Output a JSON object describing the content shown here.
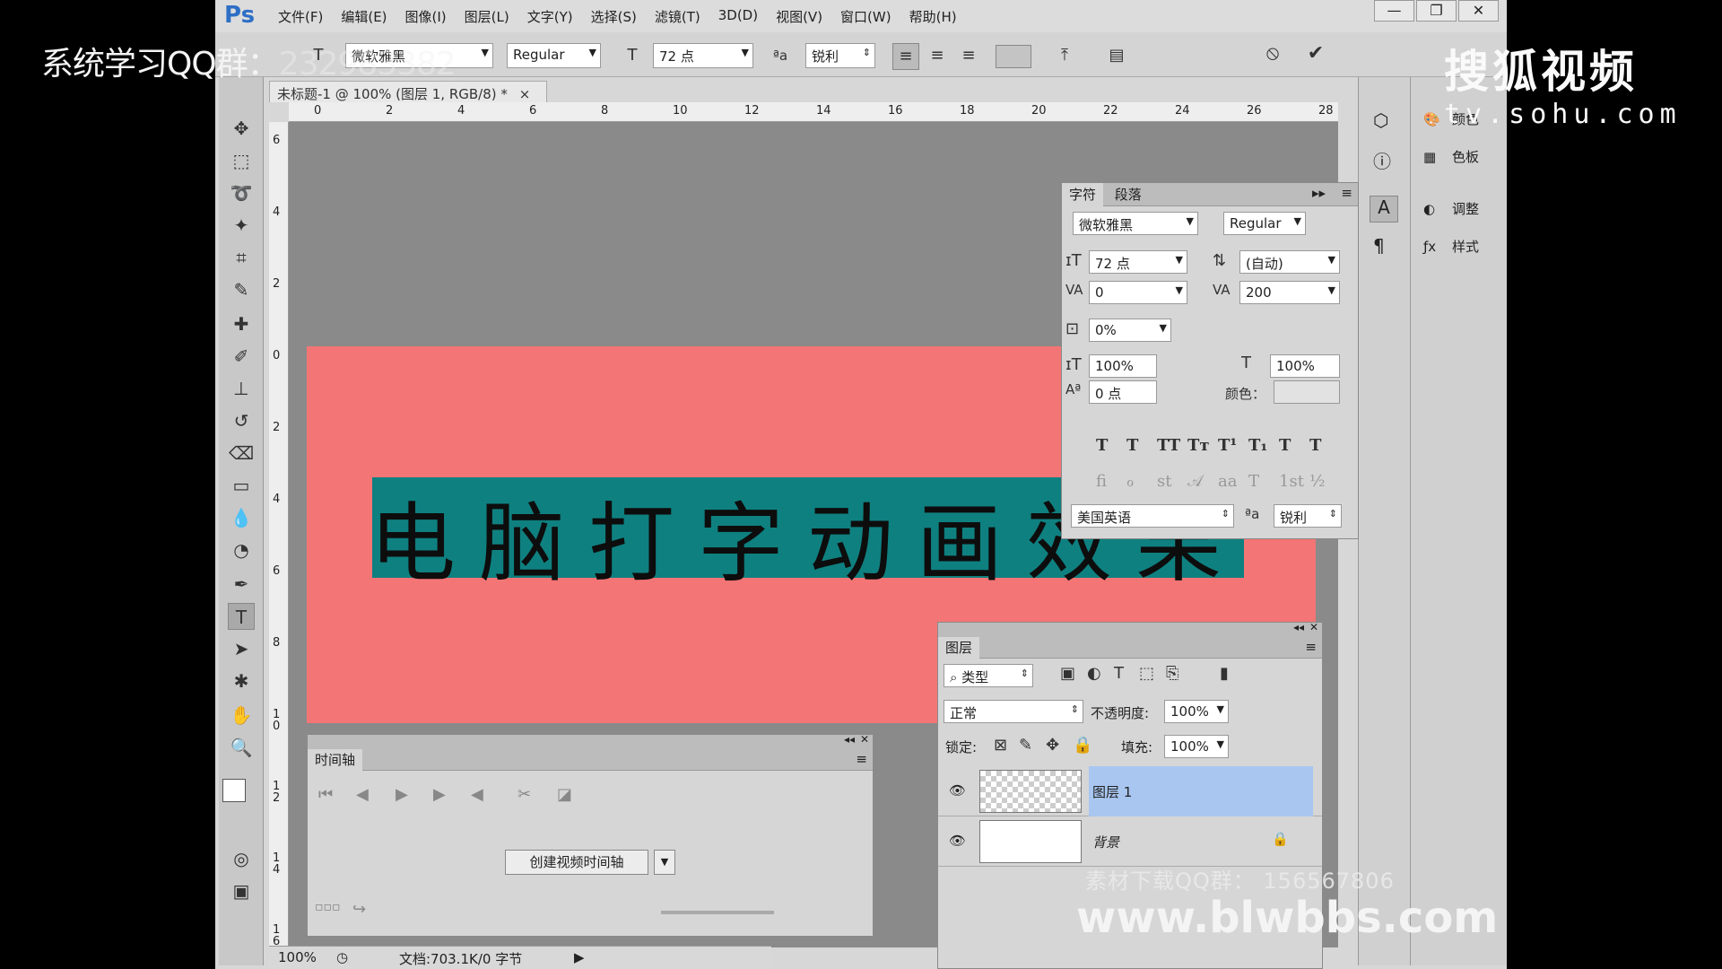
{
  "app": {
    "logo": "Ps",
    "menu": [
      "文件(F)",
      "编辑(E)",
      "图像(I)",
      "图层(L)",
      "文字(Y)",
      "选择(S)",
      "滤镜(T)",
      "3D(D)",
      "视图(V)",
      "窗口(W)",
      "帮助(H)"
    ],
    "window_buttons": [
      "—",
      "❐",
      "✕"
    ]
  },
  "options": {
    "font": "微软雅黑",
    "style": "Regular",
    "size": "72 点",
    "aa": "锐利",
    "cancel_icon": "⦸",
    "commit_icon": "✔"
  },
  "document": {
    "tab": "未标题-1 @ 100% (图层 1, RGB/8) *",
    "tab_close": "×",
    "ruler_h": [
      "0",
      "2",
      "4",
      "6",
      "8",
      "10",
      "12",
      "14",
      "16",
      "18",
      "20",
      "22",
      "24",
      "26",
      "28"
    ],
    "ruler_v": [
      "6",
      "4",
      "2",
      "0",
      "2",
      "4",
      "6",
      "8",
      "1\n0",
      "1\n2",
      "1\n4",
      "1\n6"
    ],
    "text": "电脑打字动画效果",
    "canvas_color": "#f47575",
    "selection_color": "#0f8080"
  },
  "status": {
    "zoom": "100%",
    "doc_info": "文档:703.1K/0 字节"
  },
  "character_panel": {
    "tabs": [
      "字符",
      "段落"
    ],
    "font": "微软雅黑",
    "style": "Regular",
    "size": "72 点",
    "leading": "(自动)",
    "kerning": "0",
    "tracking": "200",
    "scale_percent": "0%",
    "vscale": "100%",
    "hscale": "100%",
    "baseline": "0 点",
    "color_label": "颜色：",
    "language": "美国英语",
    "aa": "锐利",
    "aa_label": "ªa",
    "type_buttons": [
      "T",
      "T",
      "TT",
      "Tᴛ",
      "T¹",
      "T₁",
      "T",
      "T"
    ],
    "opentype_buttons": [
      "ﬁ",
      "ℴ",
      "st",
      "𝒜",
      "aa",
      "T",
      "1st",
      "½"
    ]
  },
  "right_dock": {
    "items": [
      {
        "icon": "palette-icon",
        "label": "颜色"
      },
      {
        "icon": "swatches-icon",
        "label": "色板"
      },
      {
        "icon": "adjust-icon",
        "label": "调整"
      },
      {
        "icon": "fx-icon",
        "label": "样式"
      }
    ]
  },
  "layers_panel": {
    "title": "图层",
    "filter": "类型",
    "blend_mode": "正常",
    "opacity_label": "不透明度:",
    "opacity": "100%",
    "lock_label": "锁定:",
    "fill_label": "填充:",
    "fill": "100%",
    "layers": [
      {
        "name": "图层 1",
        "selected": true
      },
      {
        "name": "背景",
        "selected": false
      }
    ]
  },
  "timeline": {
    "title": "时间轴",
    "create_button": "创建视频时间轴"
  },
  "overlays": {
    "left_watermark": "系统学习QQ群：",
    "left_watermark_ghost": "232983382",
    "sohu_brand": "搜狐视频",
    "sohu_url": "tv.sohu.com",
    "blw_qq": "素材下载QQ群：  156567806",
    "blw_url": "www.blwbbs.com"
  }
}
